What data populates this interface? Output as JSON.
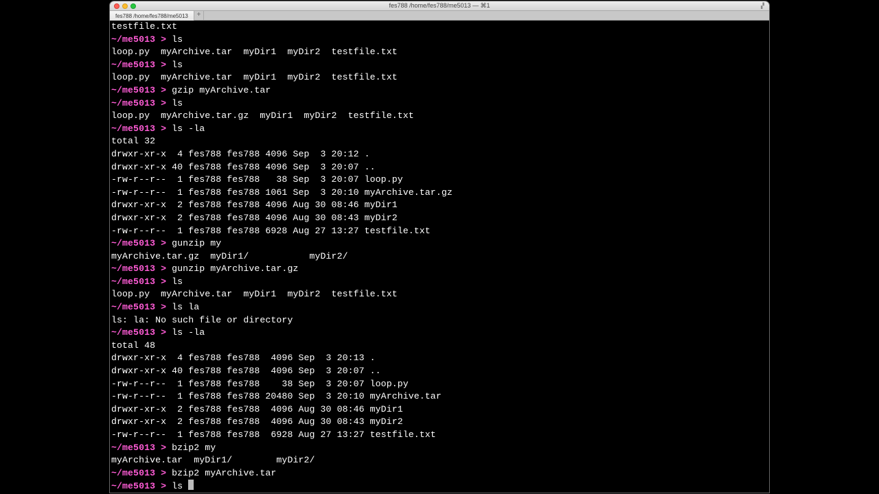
{
  "window": {
    "title": "fes788 /home/fes788/me5013 — ⌘1",
    "tab_label": "fes788 /home/fes788/me5013"
  },
  "prompt": "~/me5013 > ",
  "lines": [
    {
      "t": "out",
      "text": "testfile.txt"
    },
    {
      "t": "prompt",
      "cmd": "ls"
    },
    {
      "t": "out",
      "text": "loop.py  myArchive.tar  myDir1  myDir2  testfile.txt"
    },
    {
      "t": "prompt",
      "cmd": "ls"
    },
    {
      "t": "out",
      "text": "loop.py  myArchive.tar  myDir1  myDir2  testfile.txt"
    },
    {
      "t": "prompt",
      "cmd": "gzip myArchive.tar"
    },
    {
      "t": "prompt",
      "cmd": "ls"
    },
    {
      "t": "out",
      "text": "loop.py  myArchive.tar.gz  myDir1  myDir2  testfile.txt"
    },
    {
      "t": "prompt",
      "cmd": "ls -la"
    },
    {
      "t": "out",
      "text": "total 32"
    },
    {
      "t": "out",
      "text": "drwxr-xr-x  4 fes788 fes788 4096 Sep  3 20:12 ."
    },
    {
      "t": "out",
      "text": "drwxr-xr-x 40 fes788 fes788 4096 Sep  3 20:07 .."
    },
    {
      "t": "out",
      "text": "-rw-r--r--  1 fes788 fes788   38 Sep  3 20:07 loop.py"
    },
    {
      "t": "out",
      "text": "-rw-r--r--  1 fes788 fes788 1061 Sep  3 20:10 myArchive.tar.gz"
    },
    {
      "t": "out",
      "text": "drwxr-xr-x  2 fes788 fes788 4096 Aug 30 08:46 myDir1"
    },
    {
      "t": "out",
      "text": "drwxr-xr-x  2 fes788 fes788 4096 Aug 30 08:43 myDir2"
    },
    {
      "t": "out",
      "text": "-rw-r--r--  1 fes788 fes788 6928 Aug 27 13:27 testfile.txt"
    },
    {
      "t": "prompt",
      "cmd": "gunzip my"
    },
    {
      "t": "out",
      "text": "myArchive.tar.gz  myDir1/           myDir2/"
    },
    {
      "t": "prompt",
      "cmd": "gunzip myArchive.tar.gz"
    },
    {
      "t": "prompt",
      "cmd": "ls"
    },
    {
      "t": "out",
      "text": "loop.py  myArchive.tar  myDir1  myDir2  testfile.txt"
    },
    {
      "t": "prompt",
      "cmd": "ls la"
    },
    {
      "t": "out",
      "text": "ls: la: No such file or directory"
    },
    {
      "t": "prompt",
      "cmd": "ls -la"
    },
    {
      "t": "out",
      "text": "total 48"
    },
    {
      "t": "out",
      "text": "drwxr-xr-x  4 fes788 fes788  4096 Sep  3 20:13 ."
    },
    {
      "t": "out",
      "text": "drwxr-xr-x 40 fes788 fes788  4096 Sep  3 20:07 .."
    },
    {
      "t": "out",
      "text": "-rw-r--r--  1 fes788 fes788    38 Sep  3 20:07 loop.py"
    },
    {
      "t": "out",
      "text": "-rw-r--r--  1 fes788 fes788 20480 Sep  3 20:10 myArchive.tar"
    },
    {
      "t": "out",
      "text": "drwxr-xr-x  2 fes788 fes788  4096 Aug 30 08:46 myDir1"
    },
    {
      "t": "out",
      "text": "drwxr-xr-x  2 fes788 fes788  4096 Aug 30 08:43 myDir2"
    },
    {
      "t": "out",
      "text": "-rw-r--r--  1 fes788 fes788  6928 Aug 27 13:27 testfile.txt"
    },
    {
      "t": "prompt",
      "cmd": "bzip2 my"
    },
    {
      "t": "out",
      "text": "myArchive.tar  myDir1/        myDir2/"
    },
    {
      "t": "prompt",
      "cmd": "bzip2 myArchive.tar"
    },
    {
      "t": "prompt",
      "cmd": "ls ",
      "cursor": true
    }
  ]
}
